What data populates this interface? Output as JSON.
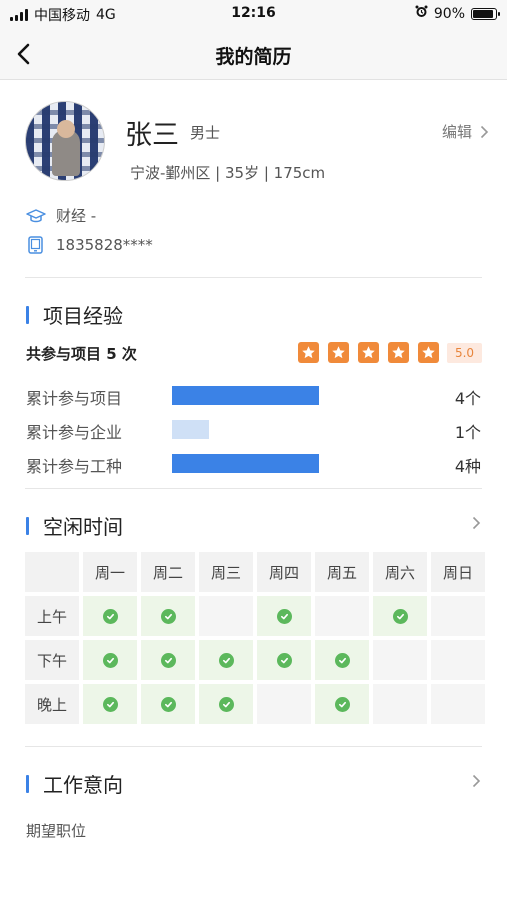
{
  "status_bar": {
    "carrier": "中国移动",
    "network": "4G",
    "time": "12:16",
    "battery": "90%",
    "battery_level": 0.9
  },
  "nav": {
    "title": "我的简历"
  },
  "profile": {
    "name": "张三",
    "gender": "男士",
    "edit_label": "编辑",
    "meta": "宁波-鄞州区 | 35岁 | 175cm",
    "education": "财经 -",
    "phone": "1835828****"
  },
  "project_experience": {
    "title": "项目经验",
    "summary": "共参与项目 5 次",
    "rating": 5,
    "score": "5.0",
    "stats": [
      {
        "label": "累计参与项目",
        "value": "4个",
        "fraction": 0.67,
        "color": "#3b82e6"
      },
      {
        "label": "累计参与企业",
        "value": "1个",
        "fraction": 0.17,
        "color": "#cfe0f6"
      },
      {
        "label": "累计参与工种",
        "value": "4种",
        "fraction": 0.67,
        "color": "#3b82e6"
      }
    ]
  },
  "free_time": {
    "title": "空闲时间",
    "days": [
      "周一",
      "周二",
      "周三",
      "周四",
      "周五",
      "周六",
      "周日"
    ],
    "periods": [
      "上午",
      "下午",
      "晚上"
    ],
    "availability": [
      [
        true,
        true,
        false,
        true,
        false,
        true,
        false
      ],
      [
        true,
        true,
        true,
        true,
        true,
        false,
        false
      ],
      [
        true,
        true,
        true,
        false,
        true,
        false,
        false
      ]
    ]
  },
  "job_intention": {
    "title": "工作意向",
    "expected_position_label": "期望职位"
  },
  "colors": {
    "accent": "#3b82e6",
    "star": "#f08a3a",
    "check": "#5cb85c"
  }
}
